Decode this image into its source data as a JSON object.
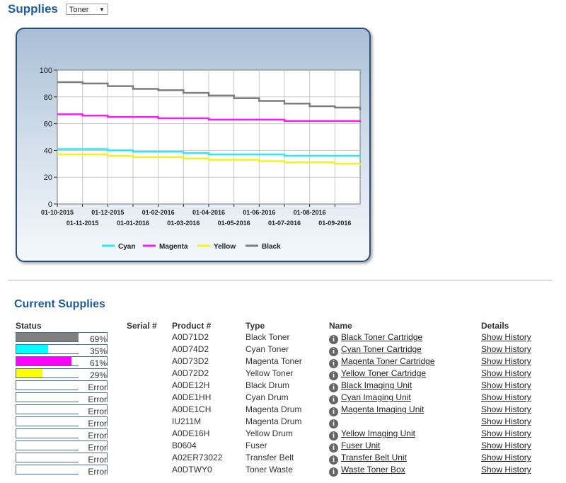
{
  "header": {
    "title": "Supplies",
    "select_value": "Toner"
  },
  "chart_data": {
    "type": "line",
    "ylim": [
      0,
      100
    ],
    "yticks": [
      0,
      20,
      40,
      60,
      80,
      100
    ],
    "x_ticks_top": [
      "01-10-2015",
      "01-12-2015",
      "01-02-2016",
      "01-04-2016",
      "01-06-2016",
      "01-08-2016"
    ],
    "x_ticks_bottom": [
      "01-11-2015",
      "01-01-2016",
      "01-03-2016",
      "01-05-2016",
      "01-07-2016",
      "01-09-2016"
    ],
    "x": [
      "01-10-2015",
      "01-11-2015",
      "01-12-2015",
      "01-01-2016",
      "01-02-2016",
      "01-03-2016",
      "01-04-2016",
      "01-05-2016",
      "01-06-2016",
      "01-07-2016",
      "01-08-2016",
      "01-09-2016",
      "30-09-2016"
    ],
    "series": [
      {
        "name": "Cyan",
        "color": "#33e6f2",
        "values": [
          41,
          41,
          40,
          39,
          39,
          38,
          37,
          37,
          37,
          36,
          36,
          36,
          35
        ]
      },
      {
        "name": "Magenta",
        "color": "#f21ff2",
        "values": [
          67,
          66,
          65,
          65,
          64,
          64,
          63,
          63,
          63,
          62,
          62,
          62,
          61
        ]
      },
      {
        "name": "Yellow",
        "color": "#f2f21f",
        "values": [
          37,
          37,
          36,
          35,
          35,
          34,
          33,
          33,
          32,
          31,
          31,
          30,
          29
        ]
      },
      {
        "name": "Black",
        "color": "#7d7d7d",
        "values": [
          91,
          90,
          88,
          86,
          85,
          83,
          81,
          79,
          77,
          75,
          73,
          72,
          70
        ]
      }
    ]
  },
  "current": {
    "title": "Current Supplies",
    "columns": [
      "Status",
      "Serial #",
      "Product #",
      "Type",
      "Name",
      "Details"
    ],
    "rows": [
      {
        "fill": 69,
        "fill_color": "#808080",
        "status": "69%",
        "product": "A0D71D2",
        "type": "Black Toner",
        "name": "Black Toner Cartridge",
        "details": "Show History"
      },
      {
        "fill": 35,
        "fill_color": "#00ffff",
        "status": "35%",
        "product": "A0D74D2",
        "type": "Cyan Toner",
        "name": "Cyan Toner Cartridge",
        "details": "Show History"
      },
      {
        "fill": 61,
        "fill_color": "#ff00ff",
        "status": "61%",
        "product": "A0D73D2",
        "type": "Magenta Toner",
        "name": "Magenta Toner Cartridge",
        "details": "Show History"
      },
      {
        "fill": 29,
        "fill_color": "#ffff00",
        "status": "29%",
        "product": "A0D72D2",
        "type": "Yellow Toner",
        "name": "Yellow Toner Cartridge",
        "details": "Show History"
      },
      {
        "fill": 0,
        "fill_color": "#ffffff",
        "status": "Error",
        "product": "A0DE12H",
        "type": "Black Drum",
        "name": "Black Imaging Unit",
        "details": "Show History"
      },
      {
        "fill": 0,
        "fill_color": "#ffffff",
        "status": "Error",
        "product": "A0DE1HH",
        "type": "Cyan Drum",
        "name": "Cyan Imaging Unit",
        "details": "Show History"
      },
      {
        "fill": 0,
        "fill_color": "#ffffff",
        "status": "Error",
        "product": "A0DE1CH",
        "type": "Magenta Drum",
        "name": "Magenta Imaging Unit",
        "details": "Show History"
      },
      {
        "fill": 0,
        "fill_color": "#ffffff",
        "status": "Error",
        "product": "IU211M",
        "type": "Magenta Drum",
        "name": "",
        "details": "Show History"
      },
      {
        "fill": 0,
        "fill_color": "#ffffff",
        "status": "Error",
        "product": "A0DE16H",
        "type": "Yellow Drum",
        "name": "Yellow Imaging Unit",
        "details": "Show History"
      },
      {
        "fill": 0,
        "fill_color": "#ffffff",
        "status": "Error",
        "product": "B0604",
        "type": "Fuser",
        "name": "Fuser Unit",
        "details": "Show History"
      },
      {
        "fill": 0,
        "fill_color": "#ffffff",
        "status": "Error",
        "product": "A02ER73022",
        "type": "Transfer Belt",
        "name": "Transfer Belt Unit",
        "details": "Show History"
      },
      {
        "fill": 0,
        "fill_color": "#ffffff",
        "status": "Error",
        "product": "A0DTWY0",
        "type": "Toner Waste",
        "name": "Waste Toner Box",
        "details": "Show History"
      }
    ]
  }
}
